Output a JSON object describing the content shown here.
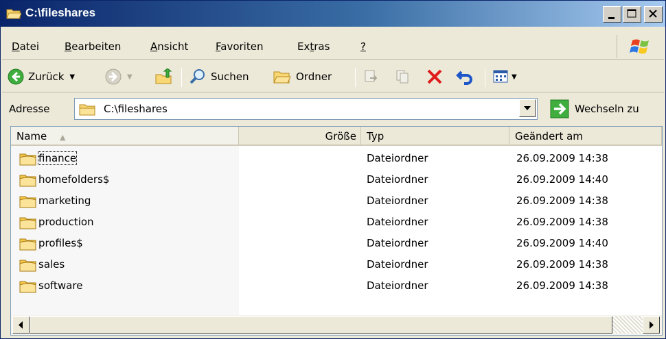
{
  "window": {
    "title": "C:\\fileshares",
    "icon": "folder-open-icon",
    "buttons": [
      "minimize-icon",
      "maximize-icon",
      "close-icon"
    ]
  },
  "menubar": {
    "items": [
      {
        "label": "Datei",
        "accel": "D"
      },
      {
        "label": "Bearbeiten",
        "accel": "B"
      },
      {
        "label": "Ansicht",
        "accel": "A"
      },
      {
        "label": "Favoriten",
        "accel": "F"
      },
      {
        "label": "Extras",
        "accel": "t"
      },
      {
        "label": "?",
        "accel": "?"
      }
    ]
  },
  "toolbar": {
    "back_label": "Zurück",
    "search_label": "Suchen",
    "folders_label": "Ordner"
  },
  "address": {
    "label": "Adresse",
    "value": "C:\\fileshares",
    "go_label": "Wechseln zu"
  },
  "list": {
    "columns": [
      "Name",
      "Größe",
      "Typ",
      "Geändert am"
    ],
    "rows": [
      {
        "name": "finance",
        "type": "Dateiordner",
        "modified": "26.09.2009 14:38"
      },
      {
        "name": "homefolders$",
        "type": "Dateiordner",
        "modified": "26.09.2009 14:40"
      },
      {
        "name": "marketing",
        "type": "Dateiordner",
        "modified": "26.09.2009 14:38"
      },
      {
        "name": "production",
        "type": "Dateiordner",
        "modified": "26.09.2009 14:38"
      },
      {
        "name": "profiles$",
        "type": "Dateiordner",
        "modified": "26.09.2009 14:40"
      },
      {
        "name": "sales",
        "type": "Dateiordner",
        "modified": "26.09.2009 14:38"
      },
      {
        "name": "software",
        "type": "Dateiordner",
        "modified": "26.09.2009 14:38"
      }
    ]
  },
  "colors": {
    "titlebar_start": "#0a246a",
    "titlebar_end": "#a6caf0",
    "chrome": "#ece9d8",
    "delete_red": "#e01b1b"
  }
}
